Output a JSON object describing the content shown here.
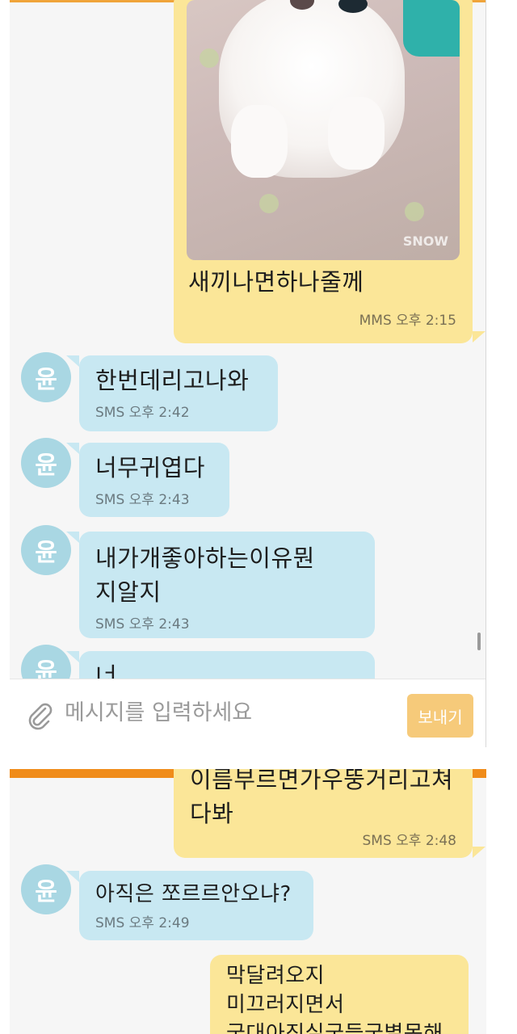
{
  "screen1": {
    "photo_message": {
      "watermark": "SNOW",
      "text": "새끼나면하나줄께",
      "meta": "MMS 오후 2:15"
    },
    "incoming": [
      {
        "avatar": "윤",
        "text": "한번데리고나와",
        "meta": "SMS 오후 2:42"
      },
      {
        "avatar": "윤",
        "text": "너무귀엽다",
        "meta": "SMS 오후 2:43"
      },
      {
        "avatar": "윤",
        "text": "내가개좋아하는이유뭔\n지알지",
        "meta": "SMS 오후 2:43"
      },
      {
        "avatar": "윤",
        "text": "너",
        "meta": ""
      }
    ],
    "input": {
      "placeholder": "메시지를 입력하세요",
      "send_label": "보내기",
      "attach_icon": "paperclip-icon"
    }
  },
  "screen2": {
    "outgoing_top": {
      "text": "이름부르면가우뚱거리고쳐\n다봐",
      "meta": "SMS 오후 2:48"
    },
    "incoming": {
      "avatar": "윤",
      "text": "아직은 쪼르르안오냐?",
      "meta": "SMS 오후 2:49"
    },
    "outgoing_bottom": {
      "text": "막달려오지\n미끄러지면서\n궁대아징실궁들궁별몽해"
    }
  },
  "colors": {
    "outgoing_bubble": "#fbe698",
    "incoming_bubble": "#c8e8f2",
    "avatar": "#a9d7e3",
    "accent": "#f08c1a",
    "send_button": "#f6ca7a"
  }
}
